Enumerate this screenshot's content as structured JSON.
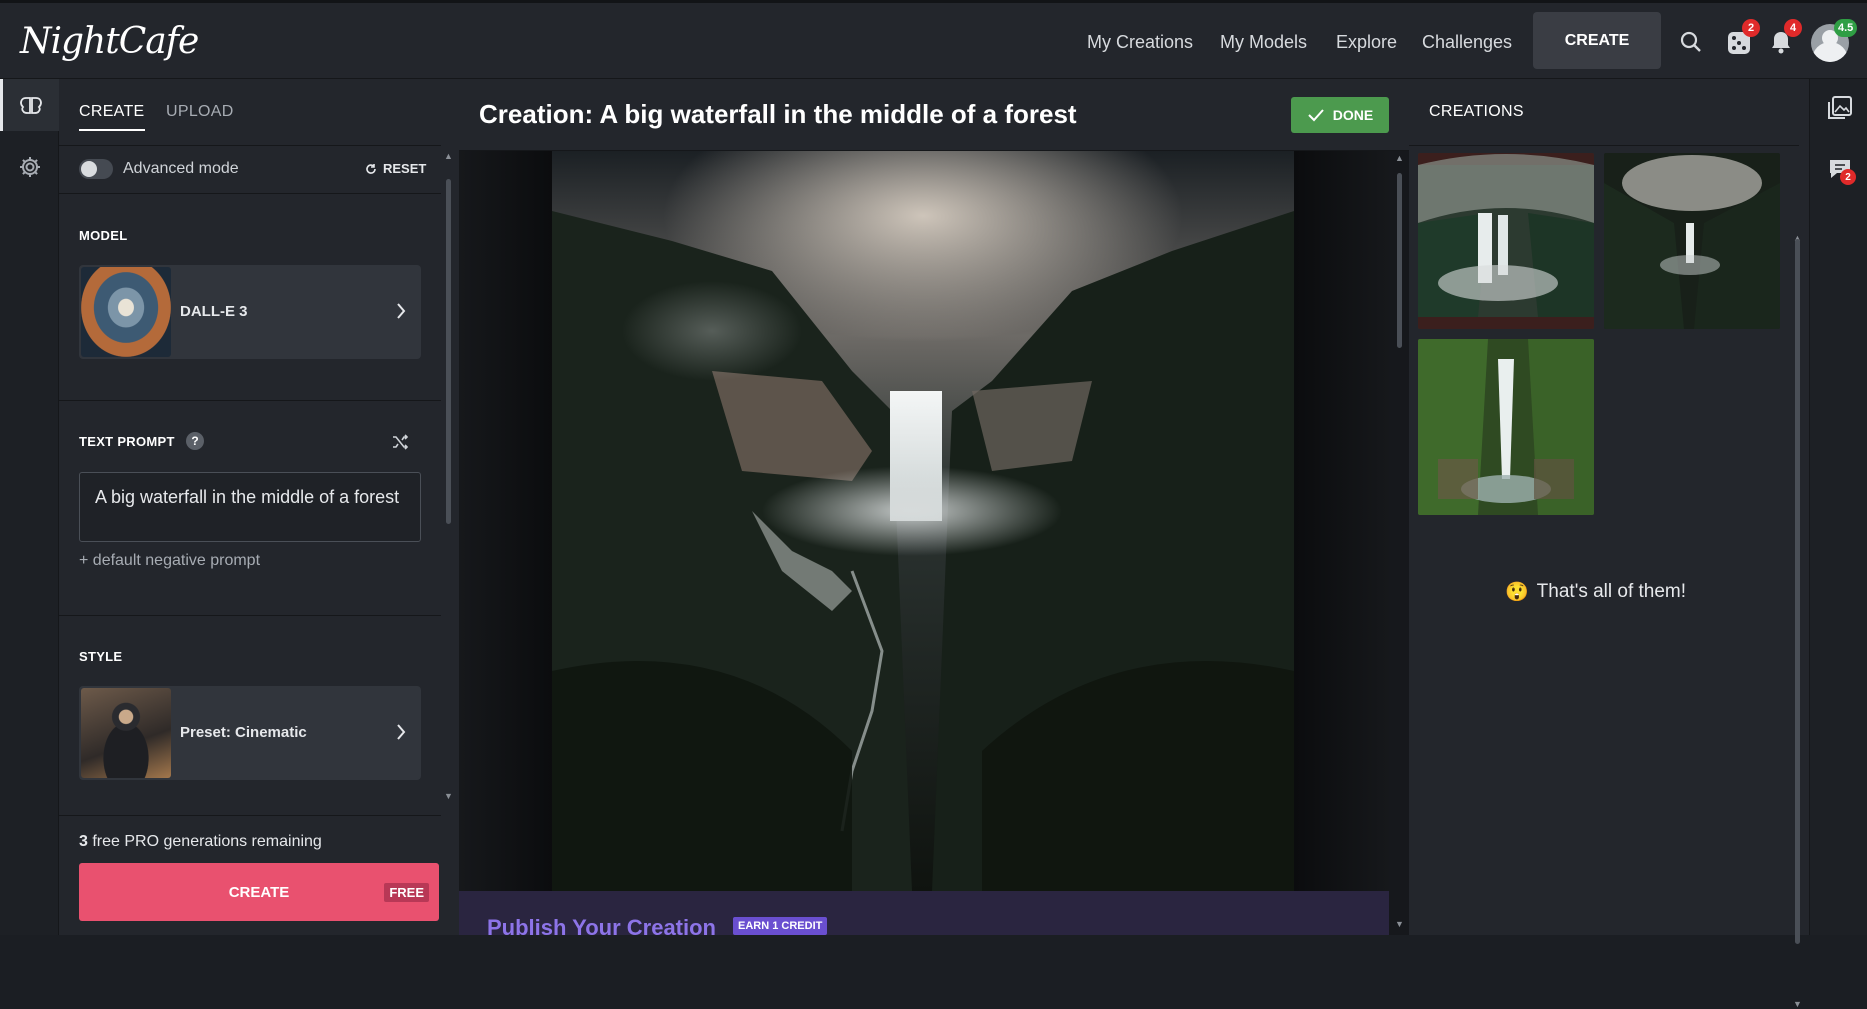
{
  "topbar": {
    "logo": "NightCafe",
    "nav": [
      "My Creations",
      "My Models",
      "Explore",
      "Challenges"
    ],
    "create_label": "CREATE",
    "dice_badge": "2",
    "bell_badge": "4",
    "avatar_badge": "4.5"
  },
  "left_tabs": {
    "create": "CREATE",
    "upload": "UPLOAD"
  },
  "settings": {
    "advanced_mode": "Advanced mode",
    "reset": "RESET"
  },
  "model": {
    "label": "MODEL",
    "name": "DALL-E 3"
  },
  "prompt": {
    "label": "TEXT PROMPT",
    "help": "?",
    "value": "A big waterfall in the middle of a forest",
    "negative": "+ default negative prompt"
  },
  "style": {
    "label": "STYLE",
    "name": "Preset: Cinematic"
  },
  "footer": {
    "count": "3",
    "remaining_text": "free PRO generations remaining",
    "create_label": "CREATE",
    "free_tag": "FREE"
  },
  "creation": {
    "title": "Creation: A big waterfall in the middle of a forest",
    "done_label": "DONE",
    "publish_title": "Publish Your Creation",
    "earn_label": "EARN 1 CREDIT"
  },
  "creations_panel": {
    "title": "CREATIONS",
    "end_emoji": "😲",
    "end_text": "That's all of them!"
  },
  "right_rail": {
    "chat_badge": "2"
  },
  "colors": {
    "accent": "#e9516f",
    "done": "#4c9a4e",
    "publish": "#8d74e8"
  }
}
